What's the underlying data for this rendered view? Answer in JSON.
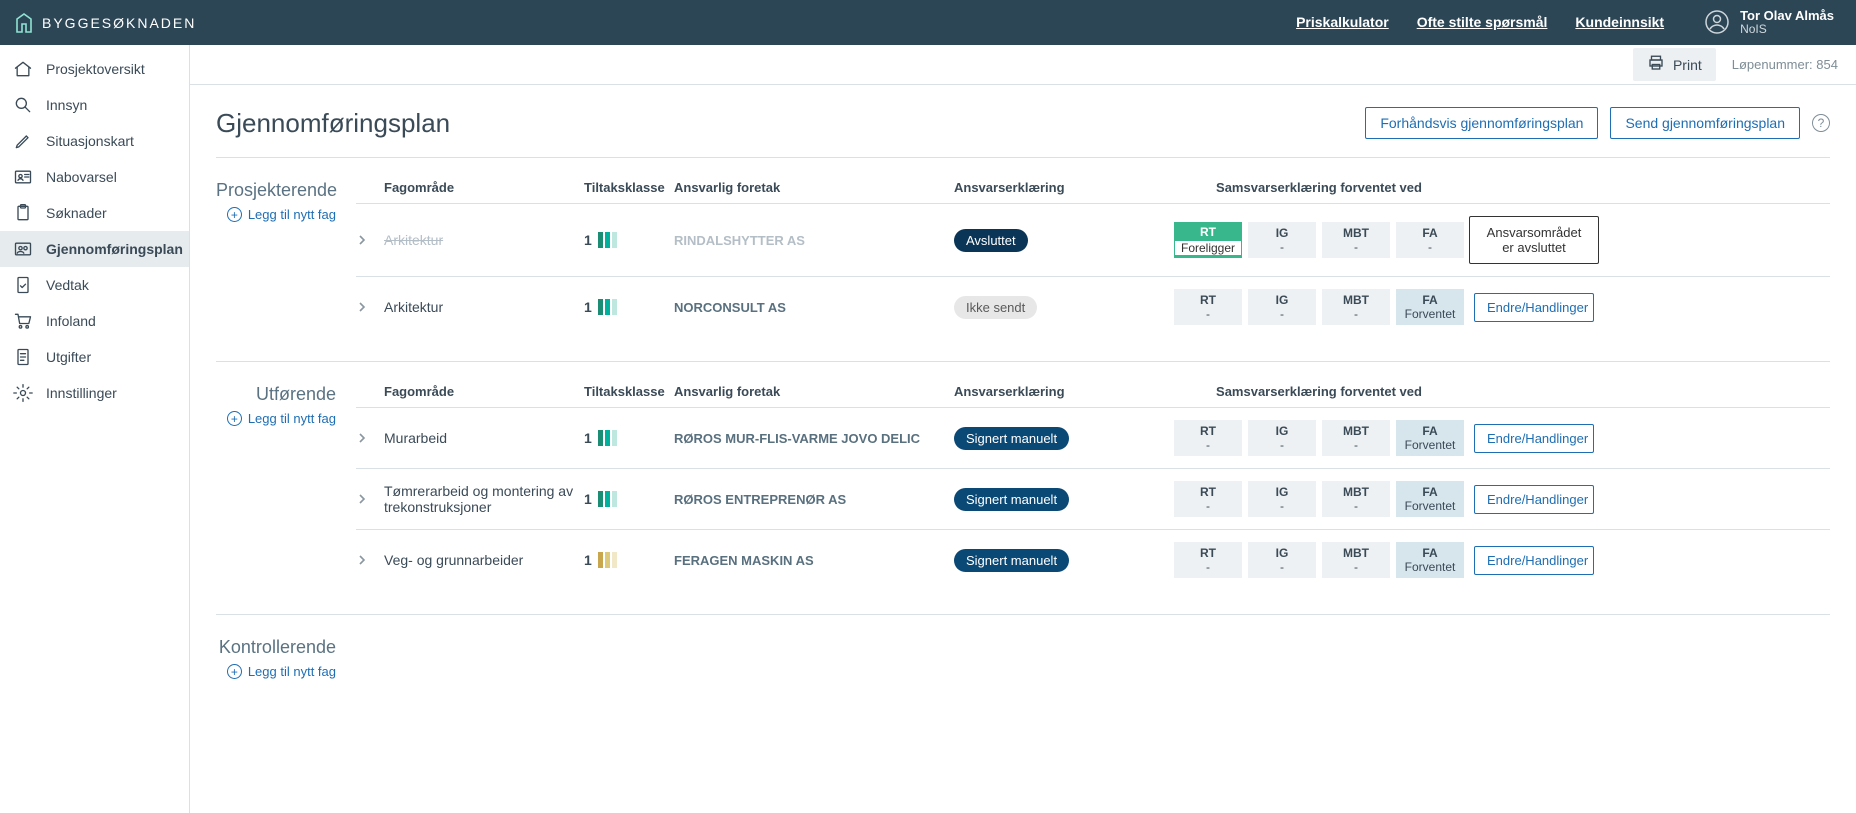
{
  "brand": {
    "name": "BYGGESØKNADEN"
  },
  "header": {
    "links": [
      {
        "label": "Priskalkulator"
      },
      {
        "label": "Ofte stilte spørsmål"
      },
      {
        "label": "Kundeinnsikt"
      }
    ],
    "user": {
      "name": "Tor Olav Almås",
      "org": "NoIS"
    }
  },
  "sidebar": {
    "items": [
      {
        "label": "Prosjektoversikt",
        "icon": "home"
      },
      {
        "label": "Innsyn",
        "icon": "search"
      },
      {
        "label": "Situasjonskart",
        "icon": "pencil"
      },
      {
        "label": "Nabovarsel",
        "icon": "idcard"
      },
      {
        "label": "Søknader",
        "icon": "clipboard"
      },
      {
        "label": "Gjennomføringsplan",
        "icon": "team",
        "active": true
      },
      {
        "label": "Vedtak",
        "icon": "doc-check"
      },
      {
        "label": "Infoland",
        "icon": "cart"
      },
      {
        "label": "Utgifter",
        "icon": "doc"
      },
      {
        "label": "Innstillinger",
        "icon": "gear"
      }
    ]
  },
  "toolbar": {
    "print": "Print",
    "serial_label": "Løpenummer:",
    "serial": "854"
  },
  "page": {
    "title": "Gjennomføringsplan",
    "preview_label": "Forhåndsvis gjennomføringsplan",
    "send_label": "Send gjennomføringsplan"
  },
  "columns": {
    "expand": "",
    "fag": "Fagområde",
    "tiltak": "Tiltaksklasse",
    "foretak": "Ansvarlig foretak",
    "ansvar": "Ansvarserklæring",
    "samsvar": "Samsvarserklæring forventet ved",
    "phases": [
      "RT",
      "IG",
      "MBT",
      "FA"
    ]
  },
  "phase_values": {
    "present": "Foreligger",
    "expected": "Forventet",
    "none": "-"
  },
  "action_labels": {
    "closed": "Ansvarsområdet er avsluttet",
    "edit": "Endre/Handlinger",
    "add": "Legg til nytt fag"
  },
  "sections": [
    {
      "title": "Prosjekterende",
      "rows": [
        {
          "done": true,
          "fag": "Arkitektur",
          "tiltak": "1",
          "bars": "teal",
          "foretak": "RINDALSHYTTER AS",
          "status": "done",
          "status_label": "Avsluttet",
          "phases": [
            "present",
            "none",
            "none",
            "none"
          ],
          "action": "closed"
        },
        {
          "done": false,
          "fag": "Arkitektur",
          "tiltak": "1",
          "bars": "teal",
          "foretak": "NORCONSULT AS",
          "status": "notsent",
          "status_label": "Ikke sendt",
          "phases": [
            "none",
            "none",
            "none",
            "expected"
          ],
          "action": "edit"
        }
      ]
    },
    {
      "title": "Utførende",
      "rows": [
        {
          "done": false,
          "fag": "Murarbeid",
          "tiltak": "1",
          "bars": "teal",
          "foretak": "RØROS MUR-FLIS-VARME JOVO DELIC",
          "status": "signed",
          "status_label": "Signert manuelt",
          "phases": [
            "none",
            "none",
            "none",
            "expected"
          ],
          "action": "edit"
        },
        {
          "done": false,
          "fag": "Tømrerarbeid og montering av trekonstruksjoner",
          "tiltak": "1",
          "bars": "teal",
          "foretak": "RØROS ENTREPRENØR AS",
          "status": "signed",
          "status_label": "Signert manuelt",
          "phases": [
            "none",
            "none",
            "none",
            "expected"
          ],
          "action": "edit"
        },
        {
          "done": false,
          "fag": "Veg- og grunnarbeider",
          "tiltak": "1",
          "bars": "amber",
          "foretak": "FERAGEN MASKIN AS",
          "status": "signed",
          "status_label": "Signert manuelt",
          "phases": [
            "none",
            "none",
            "none",
            "expected"
          ],
          "action": "edit"
        }
      ]
    },
    {
      "title": "Kontrollerende",
      "rows": []
    }
  ]
}
